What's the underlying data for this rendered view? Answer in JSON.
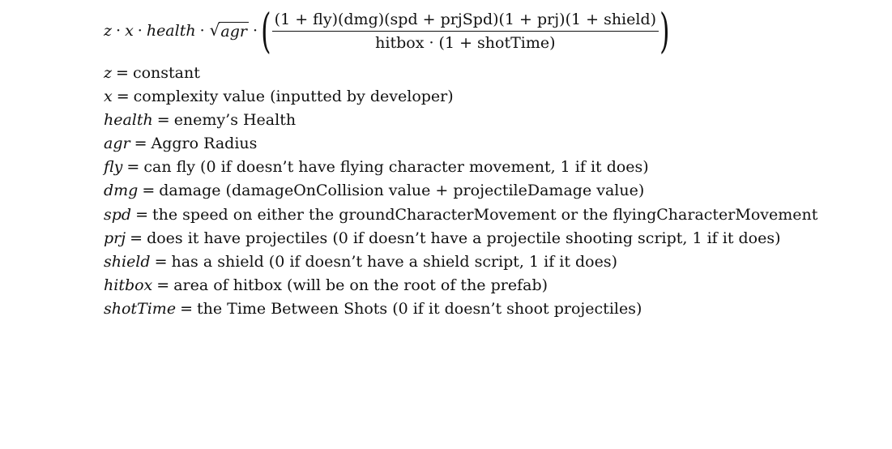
{
  "formula": {
    "z": "z",
    "x": "x",
    "health": "health",
    "agr": "agr",
    "dot": "·",
    "numerator": "(1 + fly)(dmg)(spd + prjSpd)(1 + prj)(1 + shield)",
    "denominator": "hitbox · (1 + shotTime)"
  },
  "definitions": [
    {
      "symbol": "z",
      "text": "constant"
    },
    {
      "symbol": "x",
      "text": "complexity value (inputted by developer)"
    },
    {
      "symbol": "health",
      "text": "enemy’s Health"
    },
    {
      "symbol": "agr",
      "text": "Aggro Radius"
    },
    {
      "symbol": "fly",
      "text": "can fly (0 if doesn’t have flying character movement, 1 if it does)"
    },
    {
      "symbol": "dmg",
      "text": "damage (damageOnCollision value + projectileDamage value)"
    },
    {
      "symbol": "spd",
      "text": "the speed on either the groundCharacterMovement or the flyingCharacterMovement"
    },
    {
      "symbol": "prj",
      "text": "does it have projectiles (0 if doesn’t have a projectile shooting script, 1 if it does)"
    },
    {
      "symbol": "shield",
      "text": "has a shield (0 if doesn’t have a shield script, 1 if it does)"
    },
    {
      "symbol": "hitbox",
      "text": "area of hitbox (will be on the root of the prefab)"
    },
    {
      "symbol": "shotTime",
      "text": "the Time Between Shots (0 if it doesn’t shoot projectiles)"
    }
  ]
}
